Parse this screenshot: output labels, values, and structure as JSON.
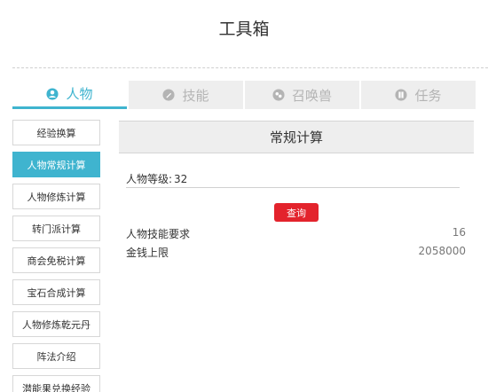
{
  "title": "工具箱",
  "tabs": [
    {
      "label": "人物",
      "icon": "person-icon"
    },
    {
      "label": "技能",
      "icon": "skill-icon"
    },
    {
      "label": "召唤兽",
      "icon": "summon-icon"
    },
    {
      "label": "任务",
      "icon": "task-icon"
    }
  ],
  "sidebar": {
    "items": [
      {
        "label": "经验换算"
      },
      {
        "label": "人物常规计算"
      },
      {
        "label": "人物修炼计算"
      },
      {
        "label": "转门派计算"
      },
      {
        "label": "商会免税计算"
      },
      {
        "label": "宝石合成计算"
      },
      {
        "label": "人物修炼乾元丹"
      },
      {
        "label": "阵法介绍"
      },
      {
        "label": "潜能果兑换经验"
      }
    ]
  },
  "panel": {
    "title": "常规计算",
    "level_label": "人物等级:",
    "level_value": "32",
    "query_label": "查询",
    "results": [
      {
        "label": "人物技能要求",
        "value": "16"
      },
      {
        "label": "金钱上限",
        "value": "2058000"
      }
    ]
  },
  "colors": {
    "accent": "#3fb4cf",
    "button": "#e3232c"
  }
}
